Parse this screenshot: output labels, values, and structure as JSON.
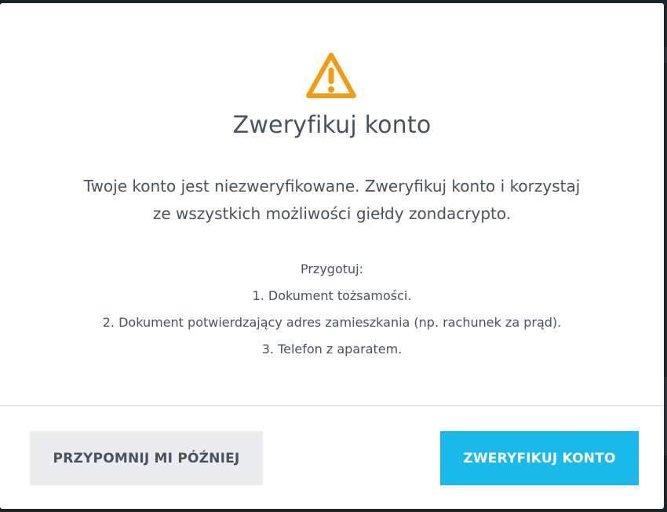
{
  "modal": {
    "title": "Zweryfikuj konto",
    "description_lines": [
      "Twoje konto jest niezweryfikowane. Zweryfikuj konto i korzystaj",
      "ze wszystkich możliwości giełdy zondacrypto."
    ],
    "prepare_heading": "Przygotuj:",
    "prepare_items": [
      "1. Dokument tożsamości.",
      "2. Dokument potwierdzający adres zamieszkania (np. rachunek za prąd).",
      "3. Telefon z aparatem."
    ],
    "icon": "warning-triangle-icon",
    "accent_color": "#f39c12"
  },
  "buttons": {
    "later_label": "PRZYPOMNIJ MI PÓŹNIEJ",
    "verify_label": "ZWERYFIKUJ KONTO",
    "verify_color": "#19baea"
  }
}
